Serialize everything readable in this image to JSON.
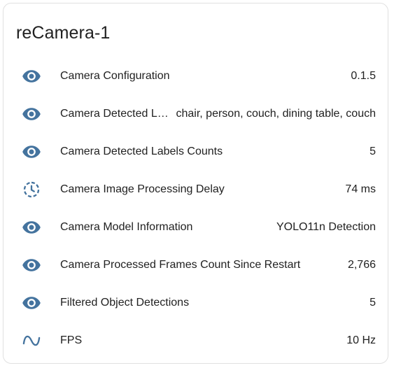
{
  "card": {
    "title": "reCamera-1"
  },
  "colors": {
    "icon": "#44739e",
    "text": "#212121",
    "border": "#e0e0e0"
  },
  "rows": [
    {
      "icon": "eye-icon",
      "label": "Camera Configuration",
      "value": "0.1.5"
    },
    {
      "icon": "eye-icon",
      "label": "Camera Detected Labels",
      "value": "chair, person, couch, dining table, couch"
    },
    {
      "icon": "eye-icon",
      "label": "Camera Detected Labels Counts",
      "value": "5"
    },
    {
      "icon": "timer-icon",
      "label": "Camera Image Processing Delay",
      "value": "74 ms"
    },
    {
      "icon": "eye-icon",
      "label": "Camera Model Information",
      "value": "YOLO11n Detection"
    },
    {
      "icon": "eye-icon",
      "label": "Camera Processed Frames Count Since Restart",
      "value": "2,766"
    },
    {
      "icon": "eye-icon",
      "label": "Filtered Object Detections",
      "value": "5"
    },
    {
      "icon": "sine-wave-icon",
      "label": "FPS",
      "value": "10 Hz"
    }
  ]
}
